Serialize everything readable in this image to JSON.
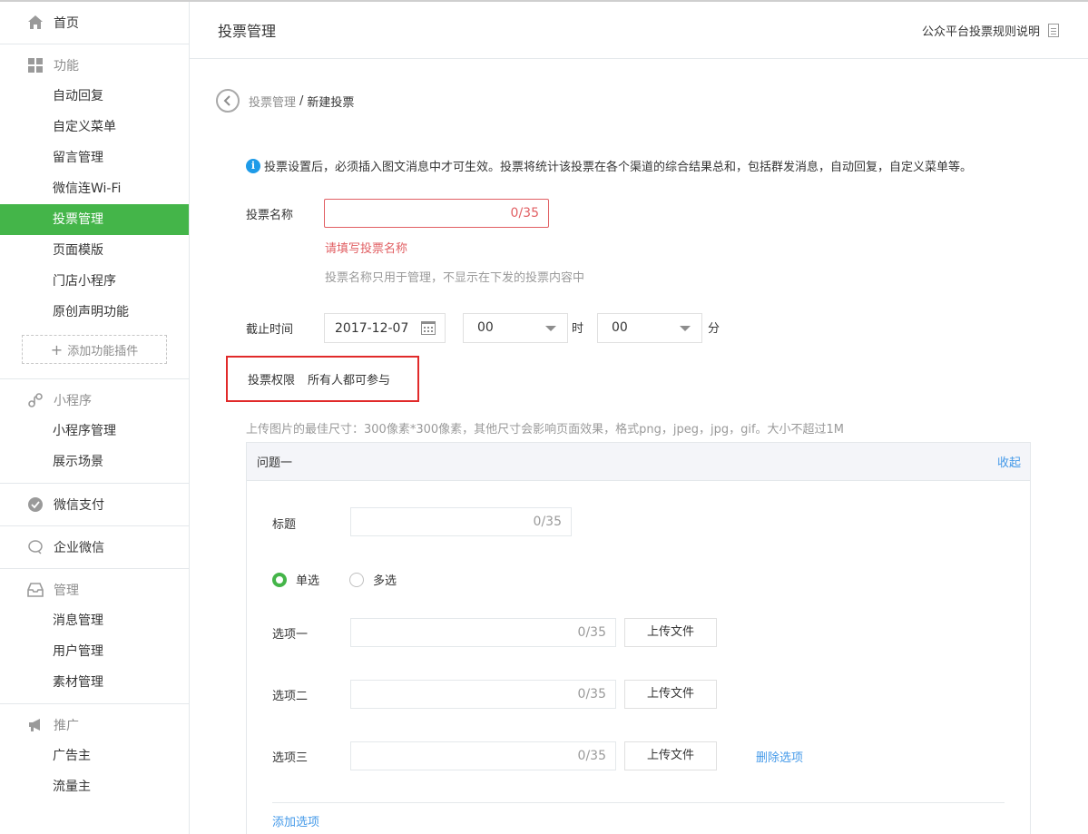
{
  "sidebar": {
    "home": "首页",
    "function": {
      "title": "功能",
      "items": [
        "自动回复",
        "自定义菜单",
        "留言管理",
        "微信连Wi-Fi",
        "投票管理",
        "页面模版",
        "门店小程序",
        "原创声明功能"
      ],
      "add_plugin": "添加功能插件"
    },
    "miniprogram": {
      "title": "小程序",
      "items": [
        "小程序管理",
        "展示场景"
      ]
    },
    "pay": "微信支付",
    "work": "企业微信",
    "manage": {
      "title": "管理",
      "items": [
        "消息管理",
        "用户管理",
        "素材管理"
      ]
    },
    "promote": {
      "title": "推广",
      "items": [
        "广告主",
        "流量主"
      ]
    }
  },
  "header": {
    "title": "投票管理",
    "rule_link": "公众平台投票规则说明"
  },
  "breadcrumb": {
    "parent": "投票管理",
    "separator": "/",
    "current": "新建投票"
  },
  "tip": "投票设置后，必须插入图文消息中才可生效。投票将统计该投票在各个渠道的综合结果总和，包括群发消息，自动回复，自定义菜单等。",
  "form": {
    "name_label": "投票名称",
    "name_counter": "0/35",
    "name_error": "请填写投票名称",
    "name_hint": "投票名称只用于管理，不显示在下发的投票内容中",
    "deadline_label": "截止时间",
    "date": "2017-12-07",
    "hour": "00",
    "hour_unit": "时",
    "minute": "00",
    "minute_unit": "分",
    "permission_label": "投票权限",
    "permission_value": "所有人都可参与",
    "image_hint": "上传图片的最佳尺寸：300像素*300像素，其他尺寸会影响页面效果，格式png，jpeg，jpg，gif。大小不超过1M"
  },
  "question": {
    "title": "问题一",
    "collapse": "收起",
    "title_label": "标题",
    "title_counter": "0/35",
    "single": "单选",
    "multiple": "多选",
    "options": [
      {
        "label": "选项一",
        "counter": "0/35",
        "upload": "上传文件"
      },
      {
        "label": "选项二",
        "counter": "0/35",
        "upload": "上传文件"
      },
      {
        "label": "选项三",
        "counter": "0/35",
        "upload": "上传文件"
      }
    ],
    "delete_option": "删除选项",
    "add_option": "添加选项"
  },
  "colors": {
    "accent": "#44b549",
    "error": "#e15f63",
    "link": "#459ae9",
    "highlight": "#e12a2a"
  }
}
